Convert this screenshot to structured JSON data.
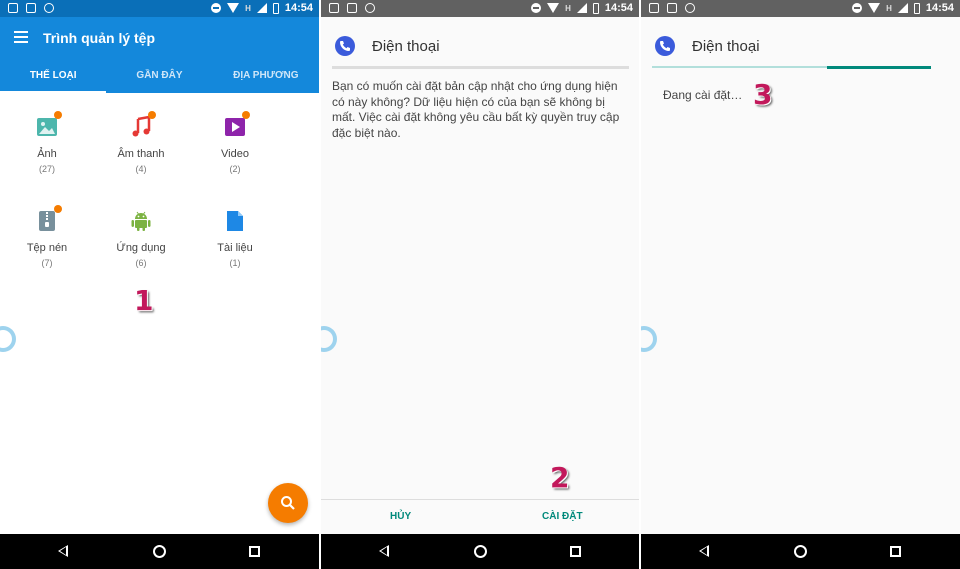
{
  "status_bar": {
    "time": "14:54",
    "network_label": "H"
  },
  "panel1": {
    "app_title": "Trình quản lý tệp",
    "tabs": [
      {
        "label": "THỂ LOẠI",
        "active": true
      },
      {
        "label": "GẦN ĐÂY",
        "active": false
      },
      {
        "label": "ĐỊA PHƯƠNG",
        "active": false
      }
    ],
    "categories": [
      {
        "label": "Ảnh",
        "count": "(27)",
        "icon": "image-icon",
        "color": "#4db6ac",
        "badge": true
      },
      {
        "label": "Âm thanh",
        "count": "(4)",
        "icon": "music-note-icon",
        "color": "#e53935",
        "badge": true
      },
      {
        "label": "Video",
        "count": "(2)",
        "icon": "video-icon",
        "color": "#8e24aa",
        "badge": true
      },
      {
        "label": "Tệp nén",
        "count": "(7)",
        "icon": "zip-archive-icon",
        "color": "#78909c",
        "badge": true
      },
      {
        "label": "Ứng dụng",
        "count": "(6)",
        "icon": "android-icon",
        "color": "#7cb342",
        "badge": false
      },
      {
        "label": "Tài liệu",
        "count": "(1)",
        "icon": "document-icon",
        "color": "#1e88e5",
        "badge": false
      }
    ],
    "step_number": "1",
    "colors": {
      "appbar": "#1488db",
      "fab": "#f57c00"
    }
  },
  "panel2": {
    "dialog_title": "Điện thoại",
    "message": "Bạn có muốn cài đặt bản cập nhật cho ứng dụng hiện có này không? Dữ liệu hiện có của bạn sẽ không bị mất. Việc cài đặt không yêu cầu bất kỳ quyền truy cập đặc biệt nào.",
    "cancel_label": "HỦY",
    "install_label": "CÀI ĐẶT",
    "step_number": "2"
  },
  "panel3": {
    "dialog_title": "Điện thoại",
    "status_text": "Đang cài đặt…",
    "step_number": "3",
    "progress": 0.3
  }
}
